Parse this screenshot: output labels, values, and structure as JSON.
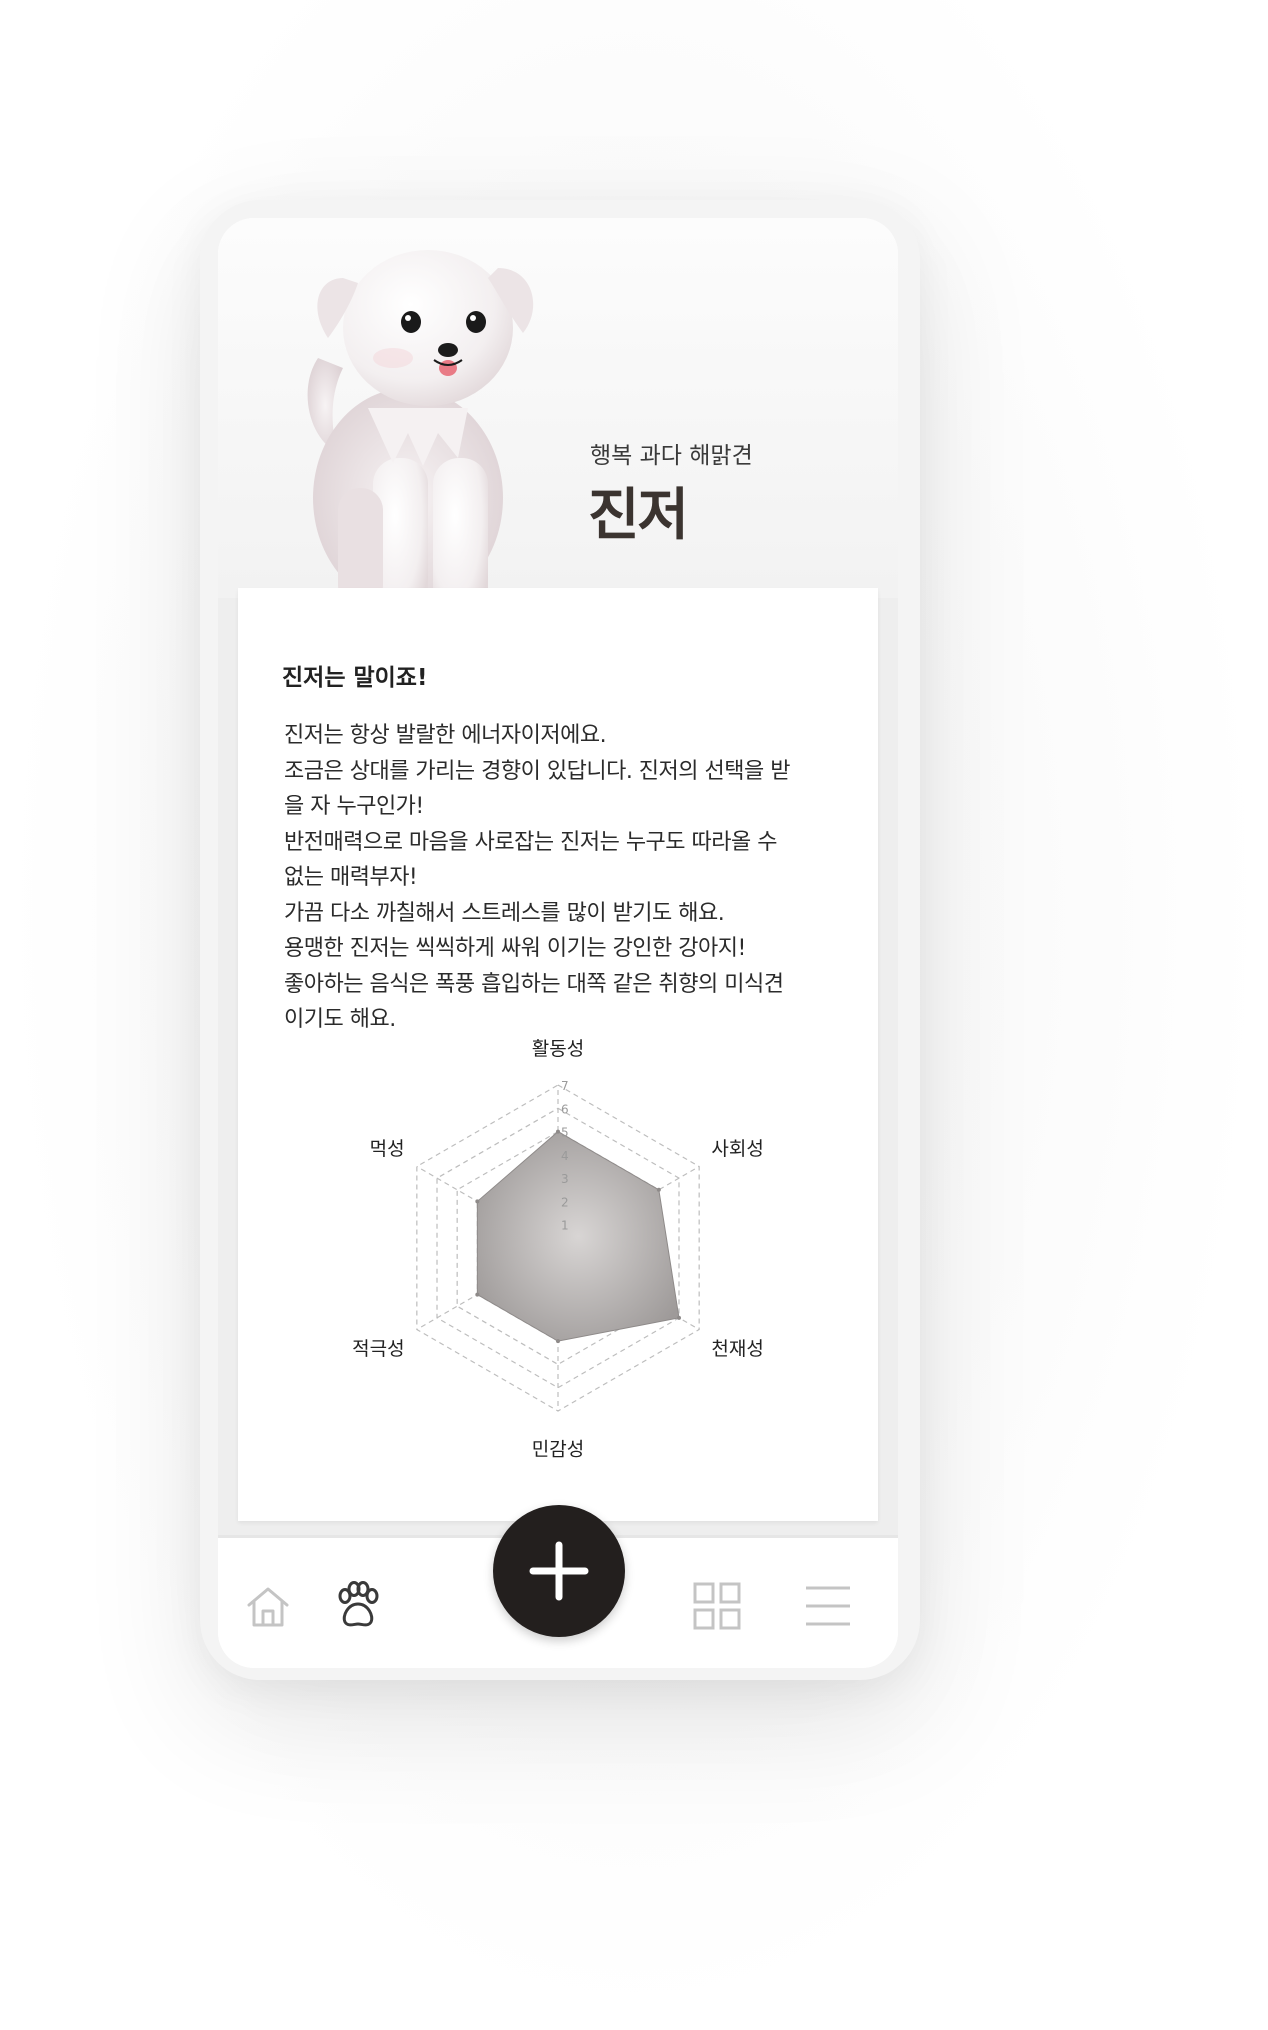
{
  "profile": {
    "subtitle": "행복 과다 해맑견",
    "name": "진저"
  },
  "card": {
    "title": "진저는 말이죠!",
    "lines": [
      "진저는 항상 발랄한 에너자이저에요.",
      "조금은 상대를 가리는 경향이 있답니다. 진저의 선택을 받",
      "을 자 누구인가!",
      "반전매력으로 마음을 사로잡는 진저는 누구도 따라올 수",
      "없는 매력부자!",
      "가끔 다소 까칠해서 스트레스를 많이 받기도 해요.",
      "용맹한 진저는 씩씩하게 싸워 이기는 강인한 강아지!",
      "좋아하는 음식은 폭풍 흡입하는 대쪽 같은 취향의 미식견",
      "이기도 해요."
    ]
  },
  "chart_data": {
    "type": "radar",
    "categories": [
      "활동성",
      "사회성",
      "천재성",
      "민감성",
      "적극성",
      "먹성"
    ],
    "values": [
      5,
      5,
      6,
      4,
      4,
      4
    ],
    "scale": {
      "min": 0,
      "max": 7,
      "ticks": [
        "1",
        "2",
        "3",
        "4",
        "5",
        "6",
        "7"
      ]
    },
    "fill_color": "#9e9a99",
    "grid": "dashed"
  },
  "nav": {
    "items": [
      {
        "icon": "home-icon"
      },
      {
        "icon": "paw-icon"
      },
      {
        "icon": "plus-icon"
      },
      {
        "icon": "grid-icon"
      },
      {
        "icon": "menu-icon"
      }
    ],
    "active": "paw-icon"
  },
  "colors": {
    "fab": "#231f1e",
    "name": "#3b3430",
    "nav_inactive": "#c4c4c4",
    "nav_active": "#3a3a3a"
  }
}
